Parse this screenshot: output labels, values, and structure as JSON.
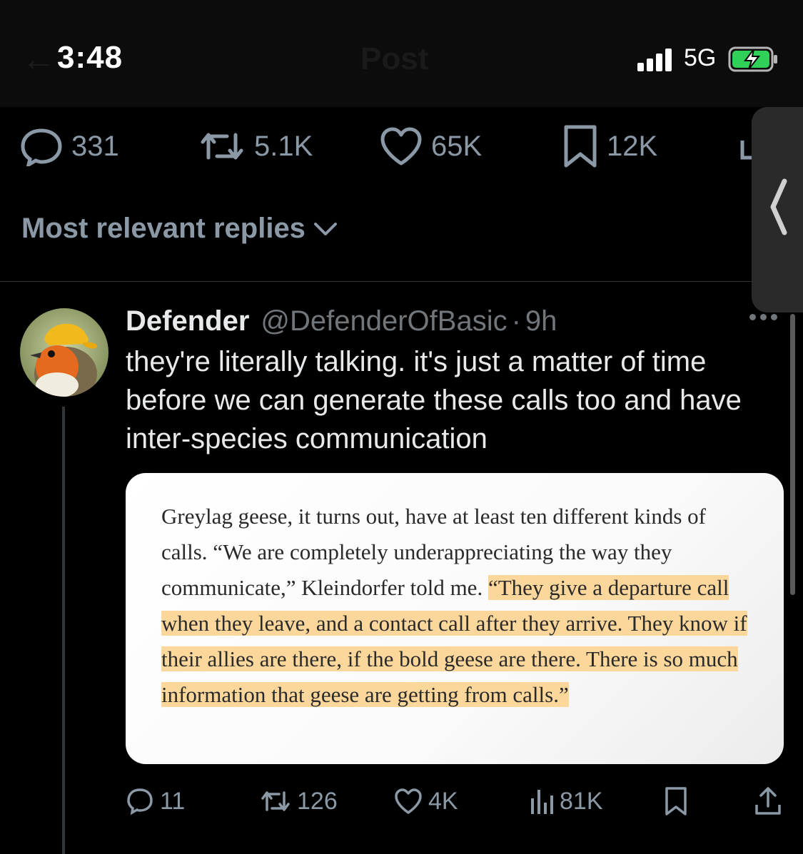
{
  "status_bar": {
    "time": "3:48",
    "network": "5G",
    "ghost_title": "Post"
  },
  "post_actions": {
    "replies": "331",
    "reposts": "5.1K",
    "likes": "65K",
    "bookmarks": "12K"
  },
  "replies_filter": {
    "label": "Most relevant replies"
  },
  "reply": {
    "name": "Defender",
    "handle": "@DefenderOfBasic",
    "separator": "·",
    "time": "9h",
    "text": "they're literally talking. it's just a matter of time before we can generate these calls too and have inter-species communication",
    "image_text": {
      "plain": "Greylag geese, it turns out, have at least ten different kinds of calls. “We are completely underappreciating the way they communicate,” Kleindorfer told me. ",
      "highlighted": "“They give a departure call when they leave, and a contact call after they arrive. They know if their allies are there, if the bold geese are there. There is so much information that geese are getting from calls.”"
    },
    "actions": {
      "replies": "11",
      "reposts": "126",
      "likes": "4K",
      "views": "81K"
    }
  },
  "colors": {
    "background": "#000000",
    "muted_text": "#8b98a5",
    "highlight": "#fbd79c"
  }
}
